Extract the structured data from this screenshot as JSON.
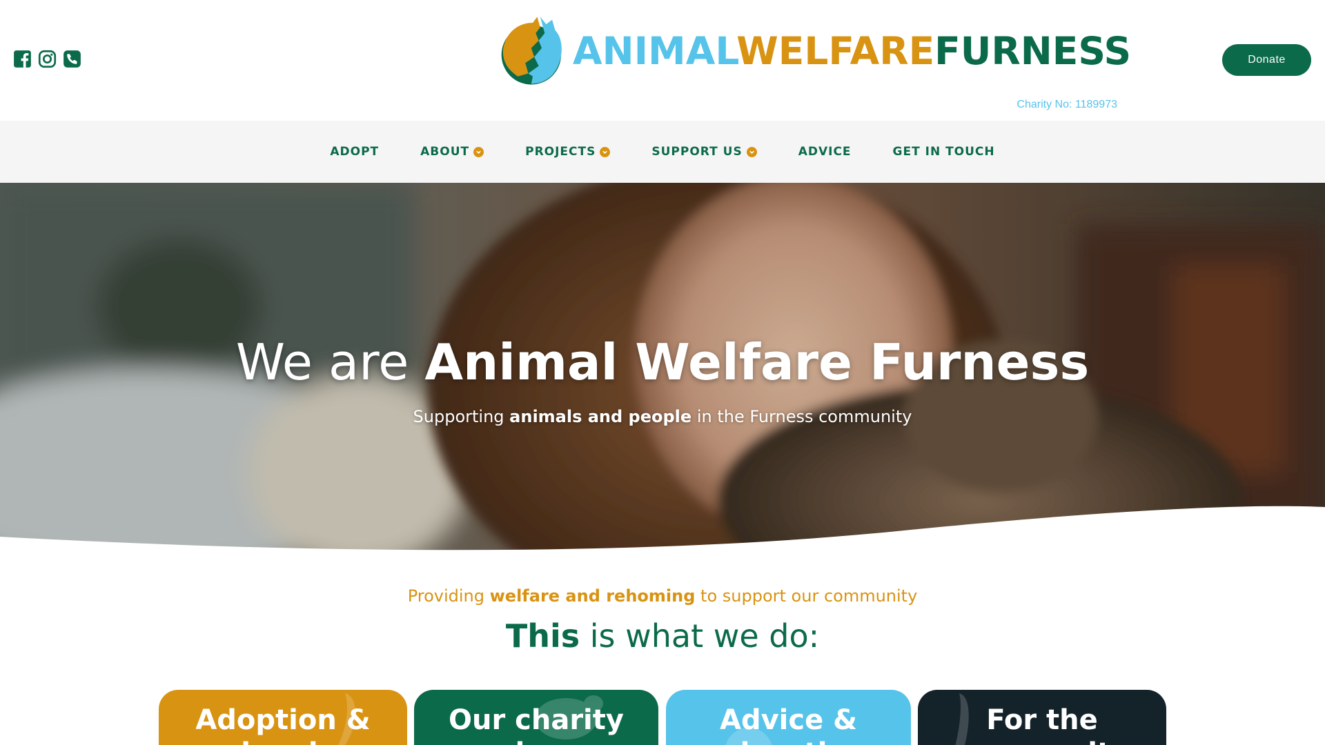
{
  "header": {
    "logo": {
      "part1": "ANIMAL",
      "part2": "WELFARE",
      "part3": "FURNESS"
    },
    "charity_no": "Charity No: 1189973",
    "donate_label": "Donate",
    "social_icons": [
      "facebook-icon",
      "instagram-icon",
      "phone-icon"
    ]
  },
  "nav": {
    "items": [
      {
        "label": "ADOPT",
        "dropdown": false
      },
      {
        "label": "ABOUT",
        "dropdown": true
      },
      {
        "label": "PROJECTS",
        "dropdown": true
      },
      {
        "label": "SUPPORT US",
        "dropdown": true
      },
      {
        "label": "ADVICE",
        "dropdown": false
      },
      {
        "label": "GET IN TOUCH",
        "dropdown": false
      }
    ]
  },
  "hero": {
    "title_prefix": "We are ",
    "title_bold": "Animal Welfare Furness",
    "sub_prefix": "Supporting ",
    "sub_bold": "animals and people",
    "sub_suffix": " in the Furness community"
  },
  "intro": {
    "line_prefix": "Providing ",
    "line_bold": "welfare and rehoming",
    "line_suffix": " to support our community",
    "title_bold": "This",
    "title_rest": " is what we do:"
  },
  "cards": [
    {
      "title": "Adoption &",
      "sub": "rehoming",
      "color": "#d99312"
    },
    {
      "title": "Our charity",
      "sub": "shop",
      "color": "#0b6a4a"
    },
    {
      "title": "Advice &",
      "sub": "education",
      "color": "#56c3ea"
    },
    {
      "title": "For the",
      "sub": "community",
      "color": "#14222a"
    }
  ],
  "colors": {
    "brand_green": "#0b6a4a",
    "brand_orange": "#d99312",
    "brand_blue": "#56c3ea",
    "nav_bg": "#f5f5f5"
  }
}
